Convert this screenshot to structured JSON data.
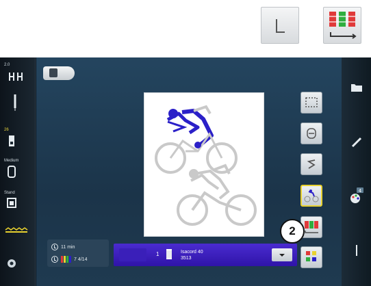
{
  "top_buttons": {
    "first_icon": "l-shape-icon",
    "second_icon": "frame-colors-icon"
  },
  "left_bar": {
    "tension_value": "2.0",
    "presser_foot_value": "26",
    "stabilizer_label": "Medium",
    "hoop_label": "Stand",
    "icons": [
      "tension-icon",
      "needle-icon",
      "presser-foot-icon",
      "stabilizer-icon",
      "hoop-icon",
      "feed-dog-icon",
      "settings-icon"
    ]
  },
  "info": {
    "time_label": "11 min",
    "colors_label": "7 4/14"
  },
  "thread": {
    "number": "1",
    "name_line1": "Isacord 40",
    "name_line2": "3513"
  },
  "badge": {
    "label": "2"
  },
  "right_bar": {
    "icons": [
      "folder-icon",
      "edit-icon",
      "color-palette-icon",
      "needle-stop-icon"
    ],
    "palette_badge": "4"
  },
  "colors": {
    "accent_yellow": "#e9d22f",
    "thread_bar": "#3a1fb9",
    "panel_blue": "#24455f",
    "embroidery_blue": "#2b20c8"
  }
}
